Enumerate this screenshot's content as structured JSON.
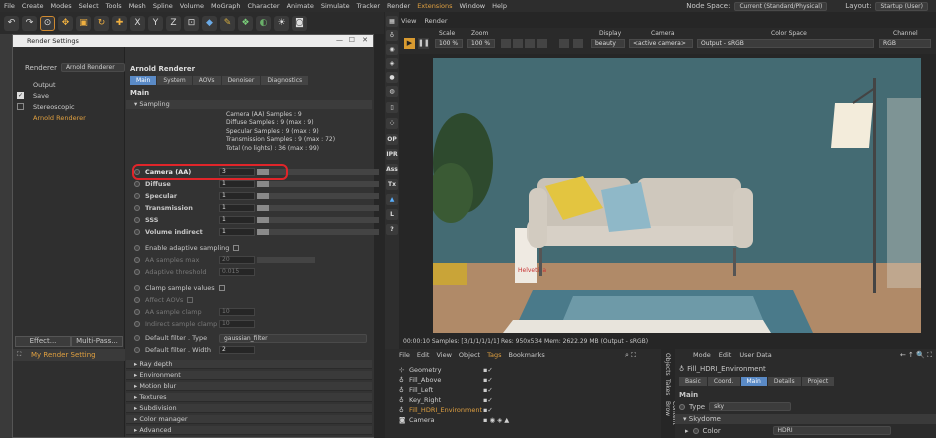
{
  "menubar": {
    "items": [
      "File",
      "Create",
      "Modes",
      "Select",
      "Tools",
      "Mesh",
      "Spline",
      "Volume",
      "MoGraph",
      "Character",
      "Animate",
      "Simulate",
      "Tracker",
      "Render",
      "Extensions",
      "Window",
      "Help"
    ],
    "highlight": "Extensions",
    "node_space_label": "Node Space:",
    "node_space_value": "Current (Standard/Physical)",
    "layout_label": "Layout:",
    "layout_value": "Startup (User)"
  },
  "render_settings": {
    "title": "Render Settings",
    "renderer_label": "Renderer",
    "renderer_value": "Arnold Renderer",
    "tree": [
      "Output",
      "Save",
      "Stereoscopic",
      "Arnold Renderer"
    ],
    "effect_button": "Effect...",
    "multipass_button": "Multi-Pass...",
    "setting_name": "My Render Setting",
    "panel_title": "Arnold Renderer",
    "tabs": [
      "Main",
      "System",
      "AOVs",
      "Denoiser",
      "Diagnostics"
    ],
    "active_tab": "Main",
    "section": "Main",
    "subsection": "Sampling",
    "info_lines": [
      "Camera (AA) Samples : 9",
      "Diffuse Samples : 9 (max : 9)",
      "Specular Samples : 9 (max : 9)",
      "Transmission Samples : 9 (max : 72)",
      "Total (no lights) : 36 (max : 99)"
    ],
    "params": [
      {
        "label": "Camera (AA)",
        "value": "3",
        "fill": 0.1
      },
      {
        "label": "Diffuse",
        "value": "1",
        "fill": 0.1
      },
      {
        "label": "Specular",
        "value": "1",
        "fill": 0.1
      },
      {
        "label": "Transmission",
        "value": "1",
        "fill": 0.1
      },
      {
        "label": "SSS",
        "value": "1",
        "fill": 0.1
      },
      {
        "label": "Volume indirect",
        "value": "1",
        "fill": 0.1
      }
    ],
    "adaptive_label": "Enable adaptive sampling",
    "aa_max_label": "AA samples max",
    "aa_max_value": "20",
    "adaptive_threshold_label": "Adaptive threshold",
    "adaptive_threshold_value": "0.015",
    "clamp_label": "Clamp sample values",
    "affect_aovs_label": "Affect AOVs",
    "aa_clamp_label": "AA sample clamp",
    "aa_clamp_value": "10",
    "indirect_clamp_label": "Indirect sample clamp",
    "indirect_clamp_value": "10",
    "filter_type_label": "Default filter . Type",
    "filter_type_value": "gaussian_filter",
    "filter_width_label": "Default filter . Width",
    "filter_width_value": "2",
    "folds": [
      "Ray depth",
      "Environment",
      "Motion blur",
      "Textures",
      "Subdivision",
      "Color manager",
      "Advanced"
    ]
  },
  "viewport": {
    "menu": [
      "View",
      "Render"
    ],
    "scale_label": "Scale",
    "scale_value": "100 %",
    "zoom_label": "Zoom",
    "zoom_value": "100 %",
    "display_label": "Display",
    "display_value": "beauty",
    "camera_label": "Camera",
    "camera_value": "<active camera>",
    "output_value": "Output - sRGB",
    "colorspace_label": "Color Space",
    "channel_label": "Channel",
    "channel_value": "RGB",
    "tools": [
      "OP",
      "IPR",
      "Ass",
      "Tx",
      "L",
      "?"
    ],
    "status": "00:00:10  Samples: [3/1/1/1/1/1]  Res: 950x534  Mem: 2622.29 MB  (Output - sRGB)"
  },
  "object_manager": {
    "menu": [
      "File",
      "Edit",
      "View",
      "Object",
      "Tags",
      "Bookmarks"
    ],
    "objects": [
      "Geometry",
      "Fill_Above",
      "Fill_Left",
      "Key_Right",
      "Fill_HDRI_Environment",
      "Camera"
    ],
    "selected": "Fill_HDRI_Environment"
  },
  "attribute_manager": {
    "menu": [
      "Mode",
      "Edit",
      "User Data"
    ],
    "object_name": "Fill_HDRI_Environment",
    "tabs": [
      "Basic",
      "Coord.",
      "Main",
      "Details",
      "Project"
    ],
    "active_tab": "Main",
    "section": "Main",
    "type_label": "Type",
    "type_value": "sky",
    "skydome_label": "Skydome",
    "color_label": "Color",
    "color_value": "HDRI"
  },
  "side_tabs": [
    "Objects",
    "Takes",
    "Content Brow"
  ],
  "colors": {
    "accent": "#5a8ac6",
    "highlight_ring": "#e0252a",
    "selected_text": "#e0a040"
  }
}
